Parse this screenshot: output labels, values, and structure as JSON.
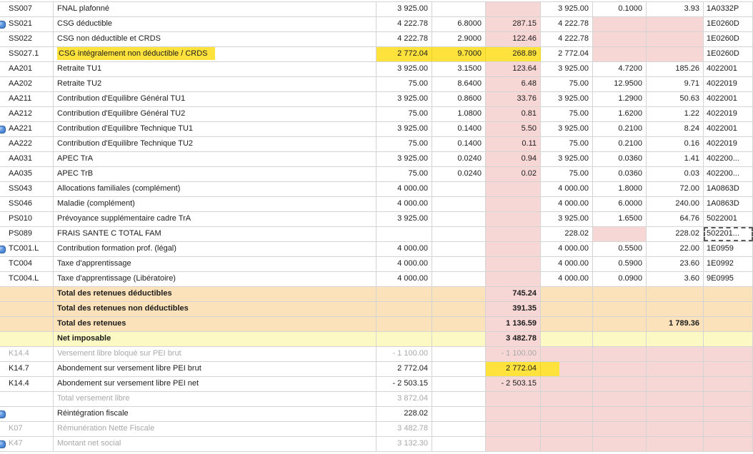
{
  "colors": {
    "grid_line": "#d4d4d4",
    "readonly_cell_pink": "#f7d6d6",
    "subtotal_row_orange": "#fbe2ba",
    "net_row_yellow": "#fdf9c4",
    "marker_highlight_yellow": "#ffe33c",
    "muted_text_gray": "#a8a8a8",
    "text": "#1c1c1c",
    "note_icon_blue": "#3a77cc"
  },
  "table": {
    "columns": [
      {
        "key": "code"
      },
      {
        "key": "label"
      },
      {
        "key": "base1"
      },
      {
        "key": "rate1"
      },
      {
        "key": "amount1"
      },
      {
        "key": "base2"
      },
      {
        "key": "rate2"
      },
      {
        "key": "amount2"
      },
      {
        "key": "ref"
      }
    ],
    "rows": [
      {
        "code": "SS007",
        "label": "FNAL plafonné",
        "base1": "3 925.00",
        "base2": "3 925.00",
        "rate2": "0.1000",
        "amount2": "3.93",
        "ref": "1A0332P"
      },
      {
        "code": "SS021",
        "label": "CSG déductible",
        "base1": "4 222.78",
        "rate1": "6.8000",
        "amount1": "287.15",
        "base2": "4 222.78",
        "ref": "1E0260D",
        "note_icon": true
      },
      {
        "code": "SS022",
        "label": "CSG non déductible et CRDS",
        "base1": "4 222.78",
        "rate1": "2.9000",
        "amount1": "122.46",
        "base2": "4 222.78",
        "ref": "1E0260D"
      },
      {
        "code": "SS027.1",
        "label": "CSG intégralement non déductible / CRDS",
        "base1": "2 772.04",
        "rate1": "9.7000",
        "amount1": "268.89",
        "base2": "2 772.04",
        "ref": "1E0260D",
        "highlights": [
          "label",
          "base1",
          "rate1",
          "amount1"
        ]
      },
      {
        "code": "AA201",
        "label": "Retraite TU1",
        "base1": "3 925.00",
        "rate1": "3.1500",
        "amount1": "123.64",
        "base2": "3 925.00",
        "rate2": "4.7200",
        "amount2": "185.26",
        "ref": "4022001"
      },
      {
        "code": "AA202",
        "label": "Retraite TU2",
        "base1": "75.00",
        "rate1": "8.6400",
        "amount1": "6.48",
        "base2": "75.00",
        "rate2": "12.9500",
        "amount2": "9.71",
        "ref": "4022019"
      },
      {
        "code": "AA211",
        "label": "Contribution d'Equilibre Général TU1",
        "base1": "3 925.00",
        "rate1": "0.8600",
        "amount1": "33.76",
        "base2": "3 925.00",
        "rate2": "1.2900",
        "amount2": "50.63",
        "ref": "4022001"
      },
      {
        "code": "AA212",
        "label": "Contribution d'Equilibre Général TU2",
        "base1": "75.00",
        "rate1": "1.0800",
        "amount1": "0.81",
        "base2": "75.00",
        "rate2": "1.6200",
        "amount2": "1.22",
        "ref": "4022019"
      },
      {
        "code": "AA221",
        "label": "Contribution d'Equilibre Technique TU1",
        "base1": "3 925.00",
        "rate1": "0.1400",
        "amount1": "5.50",
        "base2": "3 925.00",
        "rate2": "0.2100",
        "amount2": "8.24",
        "ref": "4022001",
        "note_icon": true
      },
      {
        "code": "AA222",
        "label": "Contribution d'Equilibre Technique TU2",
        "base1": "75.00",
        "rate1": "0.1400",
        "amount1": "0.11",
        "base2": "75.00",
        "rate2": "0.2100",
        "amount2": "0.16",
        "ref": "4022019"
      },
      {
        "code": "AA031",
        "label": "APEC TrA",
        "base1": "3 925.00",
        "rate1": "0.0240",
        "amount1": "0.94",
        "base2": "3 925.00",
        "rate2": "0.0360",
        "amount2": "1.41",
        "ref": "402200..."
      },
      {
        "code": "AA035",
        "label": "APEC TrB",
        "base1": "75.00",
        "rate1": "0.0240",
        "amount1": "0.02",
        "base2": "75.00",
        "rate2": "0.0360",
        "amount2": "0.03",
        "ref": "402200..."
      },
      {
        "code": "SS043",
        "label": "Allocations familiales (complément)",
        "base1": "4 000.00",
        "base2": "4 000.00",
        "rate2": "1.8000",
        "amount2": "72.00",
        "ref": "1A0863D"
      },
      {
        "code": "SS046",
        "label": "Maladie (complément)",
        "base1": "4 000.00",
        "base2": "4 000.00",
        "rate2": "6.0000",
        "amount2": "240.00",
        "ref": "1A0863D"
      },
      {
        "code": "PS010",
        "label": "Prévoyance supplémentaire cadre TrA",
        "base1": "3 925.00",
        "base2": "3 925.00",
        "rate2": "1.6500",
        "amount2": "64.76",
        "ref": "5022001"
      },
      {
        "code": "PS089",
        "label": "FRAIS SANTE C TOTAL FAM",
        "base2": "228.02",
        "amount2": "228.02",
        "ref": "502201...",
        "focus": "ref"
      },
      {
        "code": "TC001.L",
        "label": "Contribution formation prof. (légal)",
        "base1": "4 000.00",
        "base2": "4 000.00",
        "rate2": "0.5500",
        "amount2": "22.00",
        "ref": "1E0959",
        "note_icon": true
      },
      {
        "code": "TC004",
        "label": "Taxe d'apprentissage",
        "base1": "4 000.00",
        "base2": "4 000.00",
        "rate2": "0.5900",
        "amount2": "23.60",
        "ref": "1E0992"
      },
      {
        "code": "TC004.L",
        "label": "Taxe d'apprentissage (Libératoire)",
        "base1": "4 000.00",
        "base2": "4 000.00",
        "rate2": "0.0900",
        "amount2": "3.60",
        "ref": "9E0995"
      },
      {
        "label": "Total des retenues déductibles",
        "amount1": "745.24",
        "bg": "orange"
      },
      {
        "label": "Total des retenues non déductibles",
        "amount1": "391.35",
        "bg": "orange"
      },
      {
        "label": "Total des retenues",
        "amount1": "1 136.59",
        "amount2": "1 789.36",
        "bg": "orange"
      },
      {
        "label": "Net imposable",
        "amount1": "3 482.78",
        "bg": "lemon"
      },
      {
        "code": "K14.4",
        "label": "Versement libre bloqué sur PEI brut",
        "base1": "- 1 100.00",
        "amount1": "- 1 100.00",
        "muted": true
      },
      {
        "code": "K14.7",
        "label": "Abondement sur versement libre PEI brut",
        "base1": "2 772.04",
        "amount1": "2 772.04",
        "highlights": [
          "amount1"
        ],
        "spill": "base2"
      },
      {
        "code": "K14.4",
        "label": "Abondement sur versement libre PEI net",
        "base1": "- 2 503.15",
        "amount1": "- 2 503.15"
      },
      {
        "label": "Total versement libre",
        "base1": "3 872.04",
        "muted": true
      },
      {
        "label": "Réintégration fiscale",
        "base1": "228.02",
        "note_icon": true
      },
      {
        "code": "K07",
        "label": "Rémunération Nette Fiscale",
        "base1": "3 482.78",
        "muted": true
      },
      {
        "code": "K47",
        "label": "Montant net social",
        "base1": "3 132.30",
        "muted": true,
        "note_icon": true
      }
    ]
  }
}
